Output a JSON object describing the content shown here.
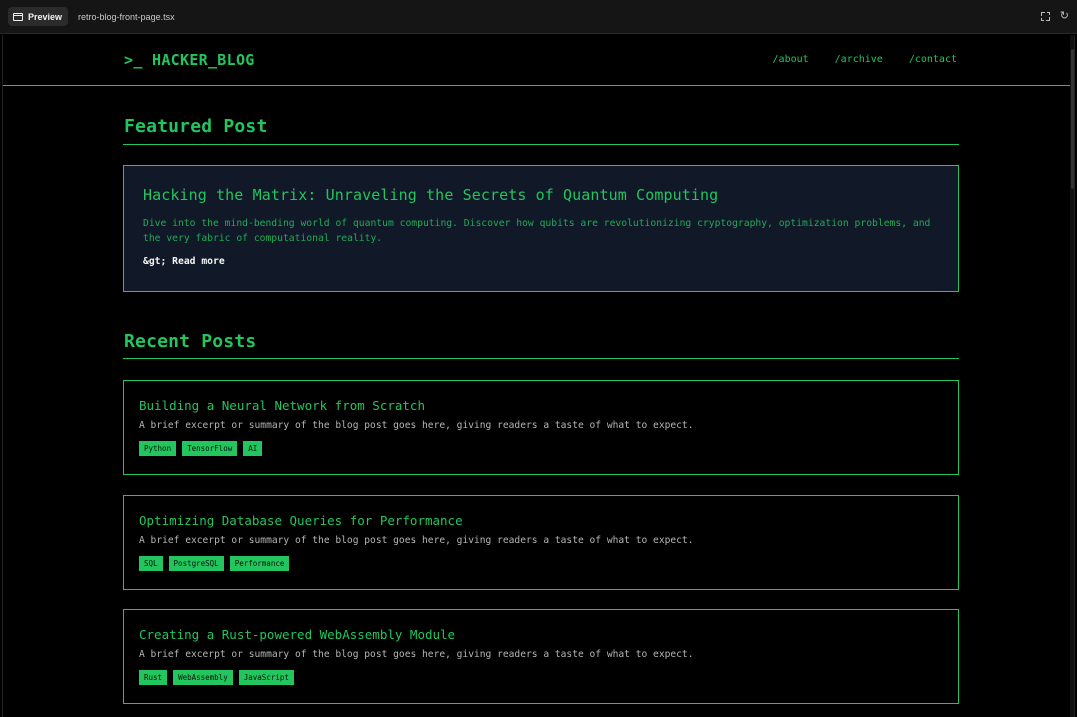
{
  "chrome": {
    "tab_label": "Preview",
    "file_name": "retro-blog-front-page.tsx"
  },
  "header": {
    "logo": ">_ HACKER_BLOG",
    "nav": [
      "/about",
      "/archive",
      "/contact"
    ]
  },
  "featured": {
    "section_title": "Featured Post",
    "title": "Hacking the Matrix: Unraveling the Secrets of Quantum Computing",
    "excerpt": "Dive into the mind-bending world of quantum computing. Discover how qubits are revolutionizing cryptography, optimization problems, and the very fabric of computational reality.",
    "read_more": "&gt; Read more"
  },
  "recent": {
    "section_title": "Recent Posts",
    "posts": [
      {
        "title": "Building a Neural Network from Scratch",
        "excerpt": "A brief excerpt or summary of the blog post goes here, giving readers a taste of what to expect.",
        "tags": [
          "Python",
          "TensorFlow",
          "AI"
        ]
      },
      {
        "title": "Optimizing Database Queries for Performance",
        "excerpt": "A brief excerpt or summary of the blog post goes here, giving readers a taste of what to expect.",
        "tags": [
          "SQL",
          "PostgreSQL",
          "Performance"
        ]
      },
      {
        "title": "Creating a Rust-powered WebAssembly Module",
        "excerpt": "A brief excerpt or summary of the blog post goes here, giving readers a taste of what to expect.",
        "tags": [
          "Rust",
          "WebAssembly",
          "JavaScript"
        ]
      }
    ]
  },
  "colors": {
    "accent": "#22c55e",
    "background": "#000000",
    "card_background": "#111827"
  }
}
